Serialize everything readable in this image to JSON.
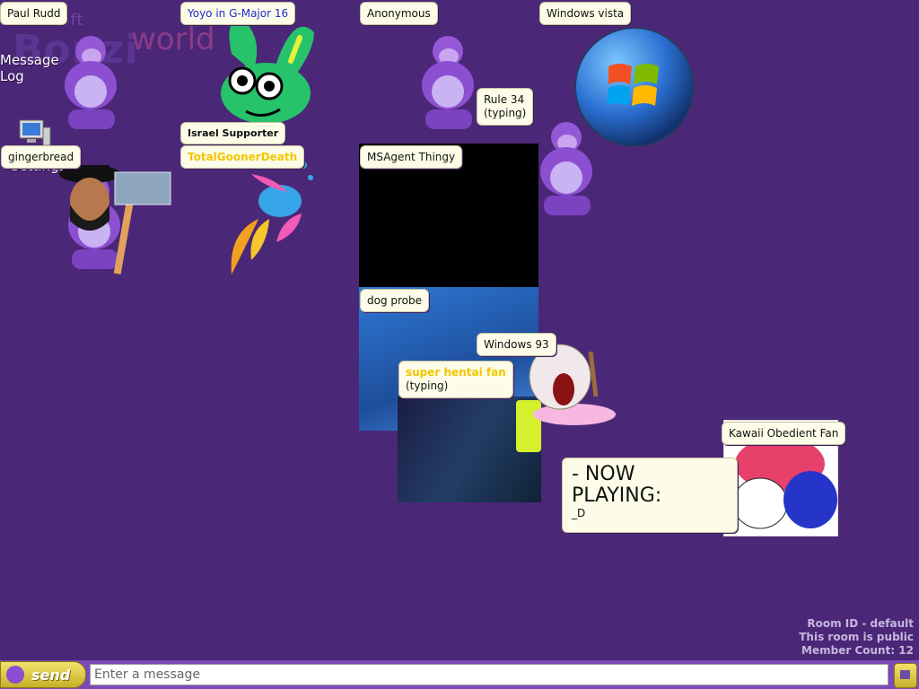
{
  "logo": {
    "small": "esoft",
    "big": "Bonzi",
    "world": "world"
  },
  "side_links": {
    "message_log": "Message Log",
    "settings": "Settings"
  },
  "tags": {
    "paul": "Paul Rudd",
    "yoyo": "Yoyo in G-Major 16",
    "anonymous": "Anonymous",
    "windows_vista": "Windows vista",
    "rule34": "Rule 34",
    "rule34_status": "(typing)",
    "israel_supporter": "Israel Supporter",
    "gingerbread": "gingerbread",
    "total_gooner": "TotalGoonerDeath",
    "msagent": "MSAgent Thingy",
    "dog_probe": "dog probe",
    "windows93": "Windows 93",
    "typing_user": "super hentai fan",
    "typing_status": "(typing)",
    "kawaii": "Kawaii Obedient Fan"
  },
  "now_playing": {
    "line1": "- NOW",
    "line2": "PLAYING:",
    "line3": "_D"
  },
  "room": {
    "id": "Room ID - default",
    "public": "This room is public",
    "count": "Member Count: 12"
  },
  "chat": {
    "send": "send",
    "placeholder": "Enter a message"
  }
}
